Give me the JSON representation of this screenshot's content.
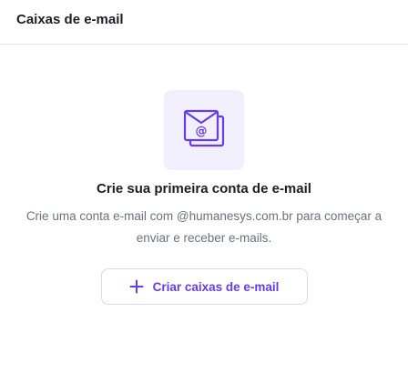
{
  "header": {
    "title": "Caixas de e-mail"
  },
  "empty_state": {
    "icon": "email-at-icon",
    "title": "Crie sua primeira conta de e-mail",
    "description": "Crie uma conta e-mail com @humanesys.com.br para começar a enviar e receber e-mails.",
    "button_label": "Criar caixas de e-mail",
    "button_icon": "plus-icon"
  },
  "colors": {
    "accent": "#673de6",
    "illustration_bg": "#f2f0ff",
    "text_primary": "#1d1e20",
    "text_secondary": "#6d7081",
    "border": "#dadce0"
  }
}
